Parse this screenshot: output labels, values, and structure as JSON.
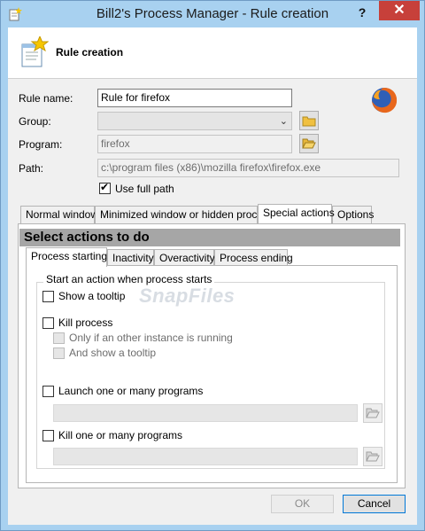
{
  "window": {
    "title": "Bill2's Process Manager - Rule creation",
    "help_label": "?",
    "close_label": "✕"
  },
  "header": {
    "title": "Rule creation"
  },
  "form": {
    "rule_name_label": "Rule name:",
    "rule_name_value": "Rule for firefox",
    "group_label": "Group:",
    "group_value": "",
    "program_label": "Program:",
    "program_value": "firefox",
    "path_label": "Path:",
    "path_value": "c:\\program files (x86)\\mozilla firefox\\firefox.exe",
    "use_full_path_label": "Use full path",
    "use_full_path_checked": true
  },
  "tabs": [
    {
      "label": "Normal window",
      "active": false
    },
    {
      "label": "Minimized window or hidden process",
      "active": false
    },
    {
      "label": "Special actions",
      "active": true
    },
    {
      "label": "Options",
      "active": false
    }
  ],
  "special_actions": {
    "section_title": "Select actions to do",
    "subtabs": [
      {
        "label": "Process starting",
        "active": true
      },
      {
        "label": "Inactivity",
        "active": false
      },
      {
        "label": "Overactivity",
        "active": false
      },
      {
        "label": "Process ending",
        "active": false
      }
    ],
    "group_legend": "Start an action when process starts",
    "show_tooltip_label": "Show a tooltip",
    "kill_process_label": "Kill process",
    "only_if_other_label": "Only if an other instance is running",
    "and_show_tooltip_label": "And show a tooltip",
    "launch_programs_label": "Launch one or many programs",
    "kill_programs_label": "Kill one or many programs",
    "watermark": "SnapFiles"
  },
  "buttons": {
    "ok_label": "OK",
    "cancel_label": "Cancel"
  },
  "colors": {
    "titlebar": "#a8d1f0",
    "close": "#c7403a",
    "section_title_bg": "#a6a6a6"
  }
}
